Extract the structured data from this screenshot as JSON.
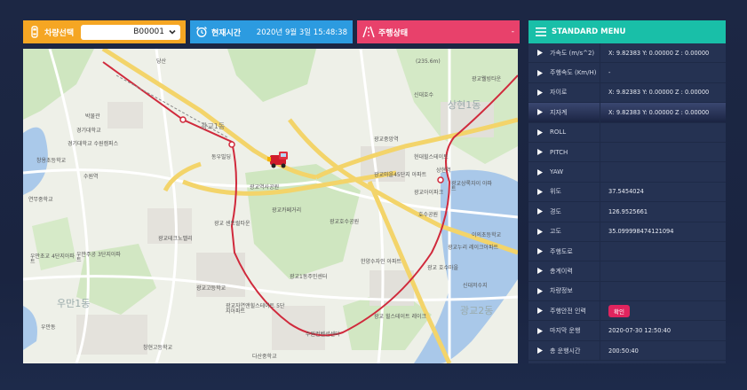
{
  "vehicle": {
    "label": "차량선택",
    "selected": "B00001",
    "icon": "car-icon"
  },
  "time": {
    "label": "현재시간",
    "value": "2020년 9월 3일 15:48:38",
    "icon": "alarm-clock-icon"
  },
  "status": {
    "label": "주행상태",
    "value": "-",
    "icon": "road-icon"
  },
  "colors": {
    "vehicle": "#f5a623",
    "time": "#2c9be0",
    "status": "#e8416b",
    "menu_header": "#19bfa8",
    "route": "#d02a3c",
    "confirm": "#e0245e"
  },
  "menu": {
    "title": "STANDARD MENU",
    "rows": [
      {
        "label": "가속도 (m/s^2)",
        "value": "X: 9.82383   Y: 0.00000   Z : 0.00000"
      },
      {
        "label": "주행속도 (Km/H)",
        "value": "-"
      },
      {
        "label": "자이로",
        "value": "X: 9.82383   Y: 0.00000   Z : 0.00000"
      },
      {
        "label": "지자계",
        "value": "X: 9.82383   Y: 0.00000   Z : 0.00000"
      },
      {
        "label": "ROLL",
        "value": ""
      },
      {
        "label": "PITCH",
        "value": ""
      },
      {
        "label": "YAW",
        "value": ""
      },
      {
        "label": "위도",
        "value": "37.5454024"
      },
      {
        "label": "경도",
        "value": "126.9525661"
      },
      {
        "label": "고도",
        "value": "35.099998474121094"
      },
      {
        "label": "주행도로",
        "value": ""
      },
      {
        "label": "총계이력",
        "value": ""
      },
      {
        "label": "차량정보",
        "value": ""
      },
      {
        "label": "주행안전 인력",
        "button": "확인"
      },
      {
        "label": "마지막 운행",
        "value": "2020-07-30 12:50:40"
      },
      {
        "label": "총 운행시간",
        "value": "200:50:40"
      }
    ]
  },
  "map": {
    "labels": [
      {
        "text": "당산"
      },
      {
        "text": "(235.6m)"
      },
      {
        "text": "상현1동"
      },
      {
        "text": "광교1동"
      },
      {
        "text": "광교중앙역"
      },
      {
        "text": "광교카페거리"
      },
      {
        "text": "광교2동"
      },
      {
        "text": "우만1동"
      },
      {
        "text": "박물관"
      },
      {
        "text": "경기대학교 수원캠퍼스"
      },
      {
        "text": "창용초등학교"
      },
      {
        "text": "수원역"
      },
      {
        "text": "연무중학교"
      },
      {
        "text": "광교호수공원"
      },
      {
        "text": "광교고등학교"
      },
      {
        "text": "광교자연앤힐스테이트 5단지아파트"
      },
      {
        "text": "동우빌딩"
      },
      {
        "text": "신대호수"
      },
      {
        "text": "경기대학교"
      },
      {
        "text": "우만초교 4단지아파트"
      },
      {
        "text": "우만주공 3단지아파트"
      },
      {
        "text": "현대힐스테이트"
      },
      {
        "text": "광교아이파크"
      },
      {
        "text": "상현역"
      },
      {
        "text": "광교웰빙타운"
      },
      {
        "text": "광교상록자이 아파트"
      },
      {
        "text": "광교누리 레이크아파트"
      },
      {
        "text": "광교역사공원"
      },
      {
        "text": "광교테크노밸리"
      },
      {
        "text": "광교 센트럴타운"
      },
      {
        "text": "광교마을45단지 아파트"
      },
      {
        "text": "한양수자인 아파트"
      },
      {
        "text": "이의초등학교"
      },
      {
        "text": "광교 힐스테이트 레이크"
      },
      {
        "text": "다산중학교"
      },
      {
        "text": "창현고등학교"
      },
      {
        "text": "우만동"
      },
      {
        "text": "신대저수지"
      },
      {
        "text": "호수공원"
      },
      {
        "text": "광교 호수마을"
      },
      {
        "text": "광교1동주민센터"
      },
      {
        "text": "수원컨벤션센터"
      }
    ]
  }
}
